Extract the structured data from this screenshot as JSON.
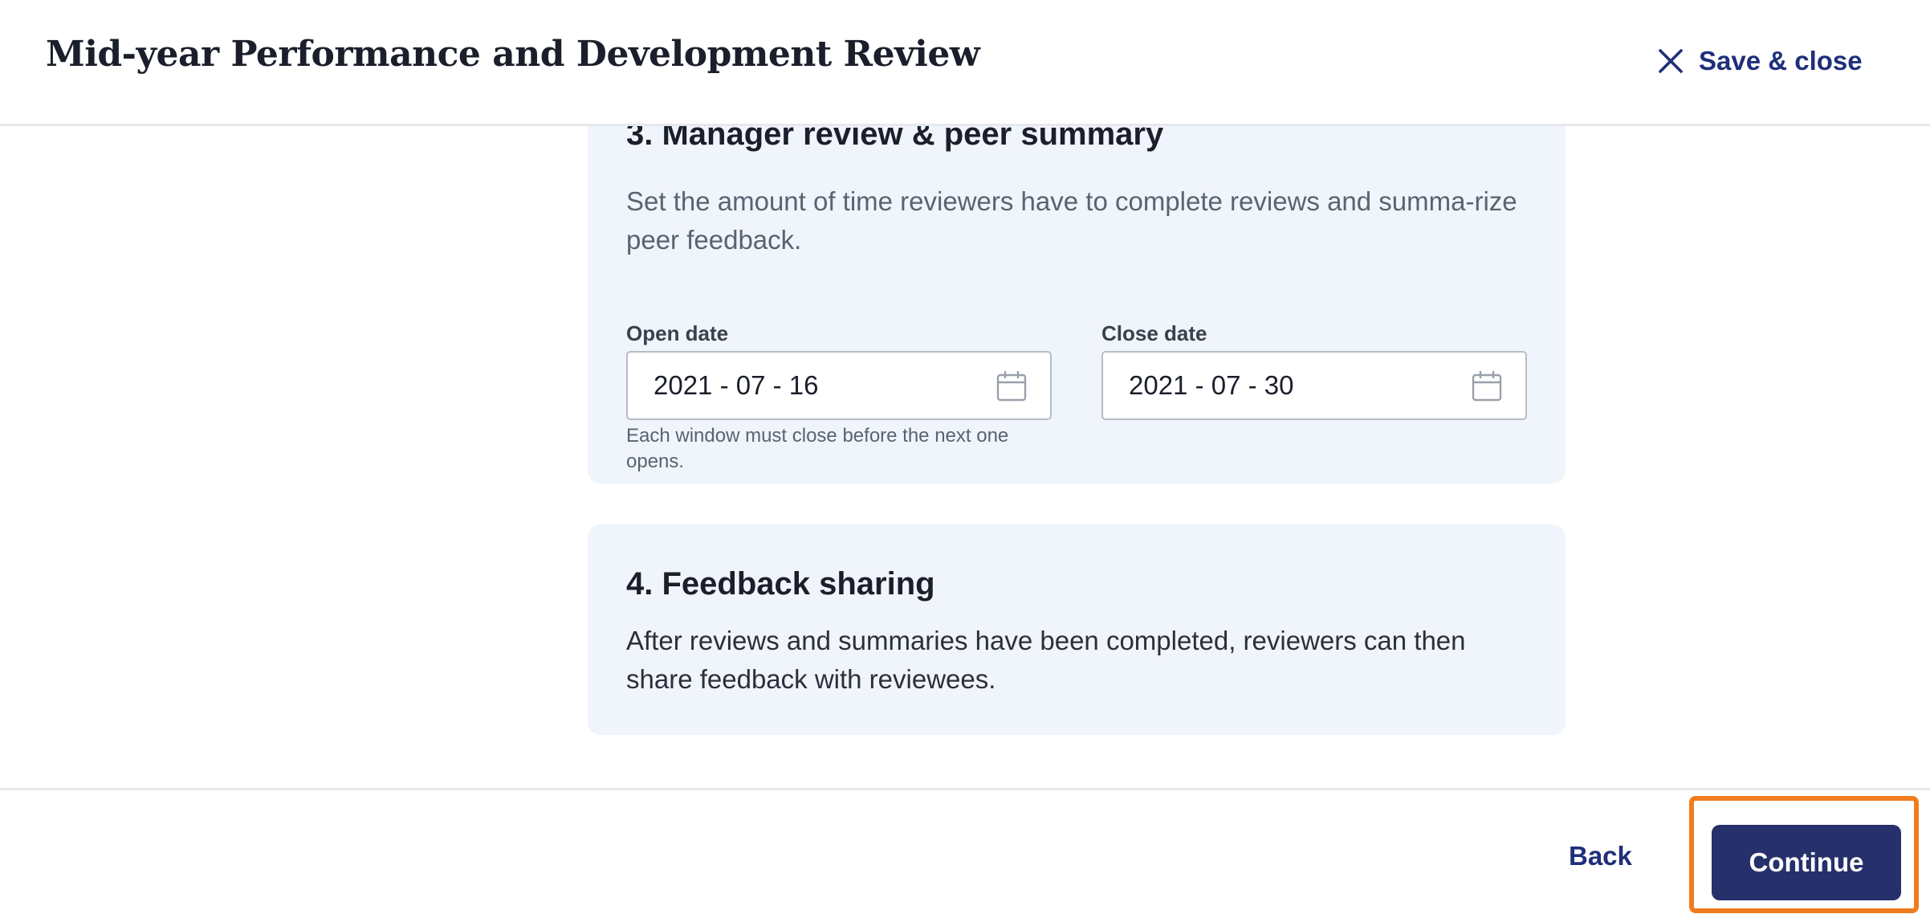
{
  "header": {
    "title": "Mid-year Performance and Development Review",
    "save_close_label": "Save & close",
    "close_icon": "close-icon"
  },
  "sections": [
    {
      "title": "3. Manager review & peer summary",
      "description": "Set the amount of time reviewers have to complete reviews and summa-rize peer feedback.",
      "open_date": {
        "label": "Open date",
        "value": "2021 - 07 - 16",
        "help": "Each window must close before the next one opens.",
        "icon": "calendar-icon"
      },
      "close_date": {
        "label": "Close date",
        "value": "2021 - 07 - 30",
        "icon": "calendar-icon"
      }
    },
    {
      "title": "4. Feedback sharing",
      "description": "After reviews and summaries have been completed, reviewers can then share feedback with reviewees."
    }
  ],
  "footer": {
    "back_label": "Back",
    "continue_label": "Continue"
  },
  "colors": {
    "accent": "#1f2f7a",
    "primary_button": "#26306a",
    "highlight": "#f07c1e",
    "card_background": "#f0f4fb"
  }
}
